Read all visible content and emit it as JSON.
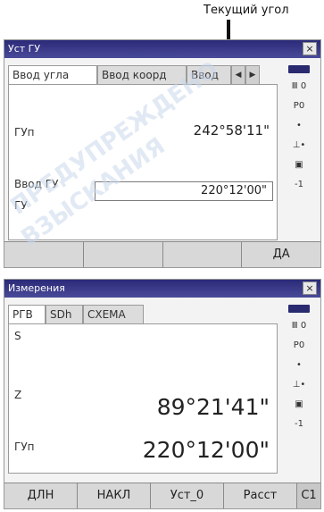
{
  "callout": {
    "text": "Текущий угол"
  },
  "window1": {
    "title": "Уст ГУ",
    "close": "×",
    "tabs": [
      "Ввод угла",
      "Ввод коорд",
      "Ввод"
    ],
    "arrow_left": "◀",
    "arrow_right": "▶",
    "hz_label": "ГУп",
    "hz_value": "242°58'11\"",
    "input_heading": "Ввод ГУ",
    "input_label": "ГУ",
    "input_value": "220°12'00\"",
    "softkeys": [
      "",
      "",
      "",
      "ДА"
    ]
  },
  "window2": {
    "title": "Измерения",
    "close": "×",
    "tabs": [
      "РГВ",
      "SDh",
      "СХЕМА"
    ],
    "s_label": "S",
    "z_label": "Z",
    "z_value": "89°21'41\"",
    "hz_label": "ГУп",
    "hz_value": "220°12'00\"",
    "softkeys": [
      "ДЛН",
      "НАКЛ",
      "Уст_0",
      "Расст"
    ],
    "page_key": "С1"
  },
  "status_icons": {
    "line1": "Ⅲ 0",
    "line2": "P0",
    "line3": "•",
    "line4": "⊥•",
    "line5": "▣",
    "line6": "-1",
    "colors": {
      "battery": "#2a2a70",
      "title_bar": "#2a2a78"
    }
  },
  "watermark": {
    "line1": "ПРЕДУПРЕЖДЕНО",
    "line2": "ВЗЫСКАНИЯ"
  }
}
